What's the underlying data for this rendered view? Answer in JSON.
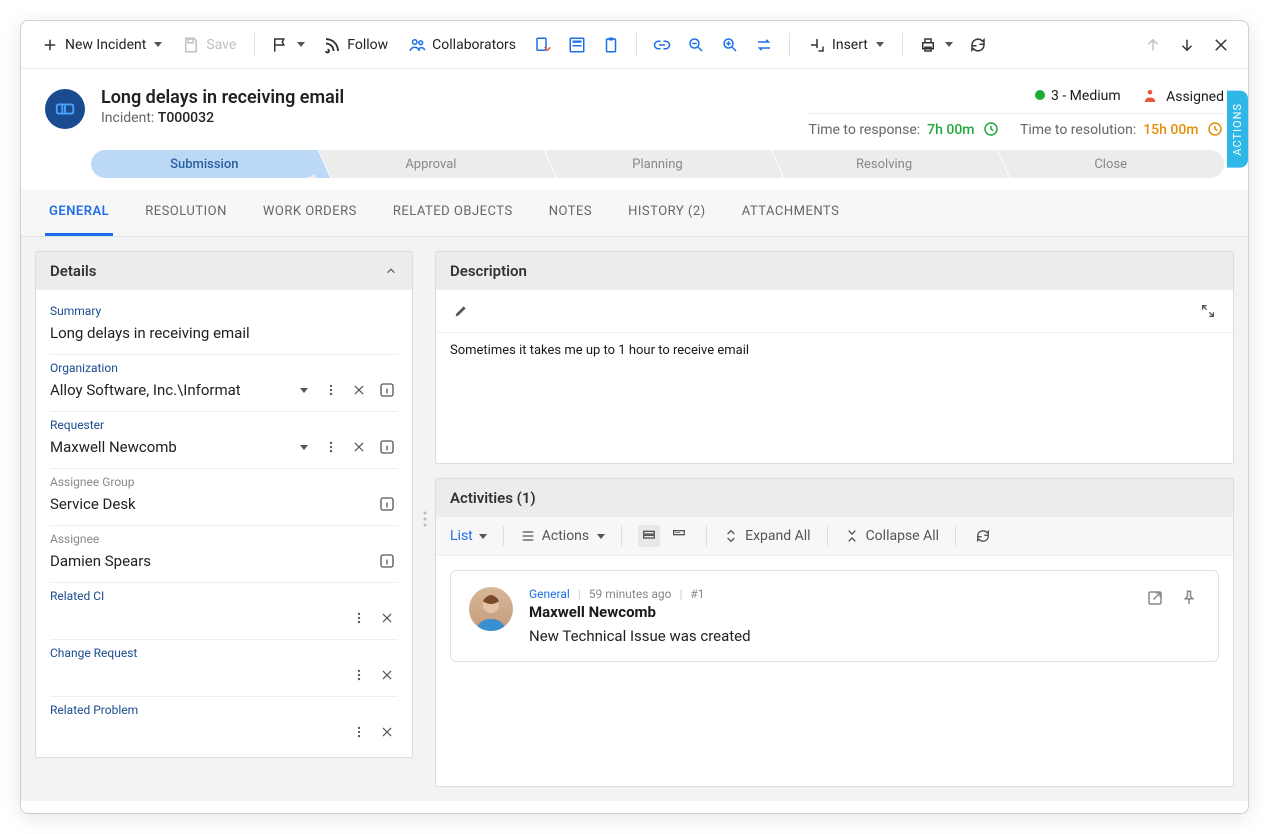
{
  "toolbar": {
    "new_incident": "New Incident",
    "save": "Save",
    "follow": "Follow",
    "collaborators": "Collaborators",
    "insert": "Insert"
  },
  "record": {
    "title": "Long delays in receiving email",
    "type_label": "Incident:",
    "number": "T000032",
    "priority": "3 - Medium",
    "status": "Assigned",
    "ttr_label": "Time to response:",
    "ttr_value": "7h 00m",
    "tt_res_label": "Time to resolution:",
    "tt_res_value": "15h 00m"
  },
  "stages": [
    "Submission",
    "Approval",
    "Planning",
    "Resolving",
    "Close"
  ],
  "active_stage_index": 0,
  "tabs": [
    "GENERAL",
    "RESOLUTION",
    "WORK ORDERS",
    "RELATED OBJECTS",
    "NOTES",
    "HISTORY (2)",
    "ATTACHMENTS"
  ],
  "active_tab_index": 0,
  "details": {
    "panel_title": "Details",
    "summary_label": "Summary",
    "summary_value": "Long delays in receiving email",
    "organization_label": "Organization",
    "organization_value": "Alloy Software, Inc.\\Informat",
    "requester_label": "Requester",
    "requester_value": "Maxwell Newcomb",
    "assignee_group_label": "Assignee Group",
    "assignee_group_value": "Service Desk",
    "assignee_label": "Assignee",
    "assignee_value": "Damien Spears",
    "related_ci_label": "Related CI",
    "related_ci_value": "",
    "change_request_label": "Change Request",
    "change_request_value": "",
    "related_problem_label": "Related Problem",
    "related_problem_value": ""
  },
  "description": {
    "panel_title": "Description",
    "body": "Sometimes it takes me up to 1 hour to receive email"
  },
  "activities": {
    "panel_title": "Activities (1)",
    "view_mode": "List",
    "actions_label": "Actions",
    "expand_all": "Expand All",
    "collapse_all": "Collapse All",
    "items": [
      {
        "category": "General",
        "time": "59 minutes ago",
        "seq": "#1",
        "user": "Maxwell Newcomb",
        "text": "New Technical Issue was created"
      }
    ]
  },
  "side_tab": "ACTIONS"
}
